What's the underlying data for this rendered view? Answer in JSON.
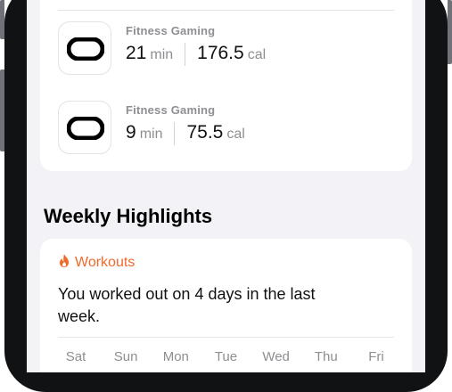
{
  "workouts": [
    {
      "source": "Fitness Gaming",
      "duration_value": "21",
      "duration_unit": "min",
      "energy_value": "176.5",
      "energy_unit": "cal",
      "icon": "vr-headset-icon"
    },
    {
      "source": "Fitness Gaming",
      "duration_value": "9",
      "duration_unit": "min",
      "energy_value": "75.5",
      "energy_unit": "cal",
      "icon": "vr-headset-icon"
    }
  ],
  "weekly_highlights": {
    "title": "Weekly Highlights",
    "badge": {
      "label": "Workouts",
      "icon": "flame-icon",
      "color": "#f06a2b"
    },
    "text": "You worked out on 4 days in the last week.",
    "days": [
      "Sat",
      "Sun",
      "Mon",
      "Tue",
      "Wed",
      "Thu",
      "Fri"
    ]
  }
}
